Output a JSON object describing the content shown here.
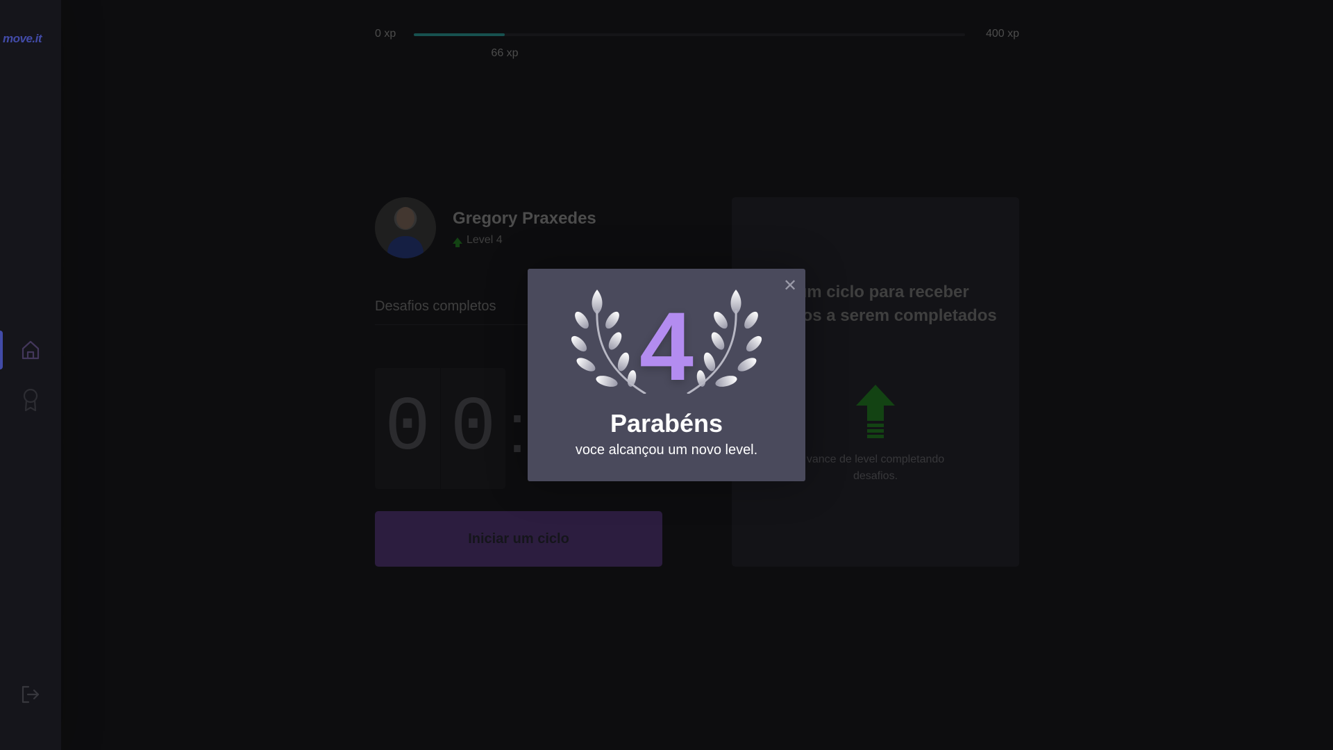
{
  "sidebar": {
    "logo": "move.it",
    "items": [
      {
        "icon": "home-icon"
      },
      {
        "icon": "award-icon"
      }
    ],
    "logout_icon": "logout-icon"
  },
  "xp": {
    "min_label": "0 xp",
    "max_label": "400 xp",
    "current_label": "66 xp",
    "progress_fraction": 0.165
  },
  "profile": {
    "name": "Gregory Praxedes",
    "level_label": "Level 4"
  },
  "challenges": {
    "label": "Desafios completos"
  },
  "countdown": {
    "digits": [
      "0",
      "0"
    ],
    "separator": ":"
  },
  "start_button": {
    "label": "Iniciar um ciclo"
  },
  "challenge_box": {
    "title": "o um ciclo para receber desafios a serem completados",
    "hint": "vance de level completando desafios."
  },
  "modal": {
    "level": "4",
    "title": "Parabéns",
    "text": "voce alcançou um novo level."
  },
  "colors": {
    "accent": "#5965e0",
    "modal_level": "#b38cf0",
    "xp_fill": "#1f6d6a",
    "level_up": "#1a5a1a"
  }
}
